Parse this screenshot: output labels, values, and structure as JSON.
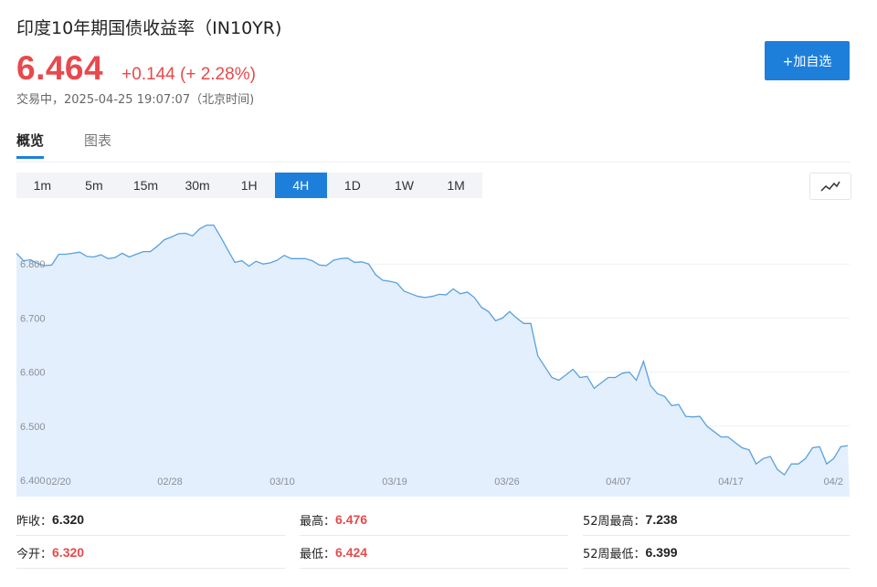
{
  "header": {
    "title": "印度10年期国债收益率（IN10YR)",
    "price": "6.464",
    "change": "+0.144 (+ 2.28%)",
    "status": "交易中，",
    "timestamp": "2025-04-25 19:07:07（北京时间)",
    "add_button": "+加自选"
  },
  "tabs": [
    {
      "label": "概览",
      "active": true
    },
    {
      "label": "图表",
      "active": false
    }
  ],
  "intervals": [
    {
      "label": "1m"
    },
    {
      "label": "5m"
    },
    {
      "label": "15m"
    },
    {
      "label": "30m"
    },
    {
      "label": "1H"
    },
    {
      "label": "4H",
      "active": true
    },
    {
      "label": "1D"
    },
    {
      "label": "1W"
    },
    {
      "label": "1M"
    }
  ],
  "chart_type_icon": "line-chart-icon",
  "colors": {
    "accent": "#1e7fdb",
    "up": "#e8494c",
    "line": "#5aa0e0",
    "area": "#e3effc"
  },
  "chart_data": {
    "type": "area",
    "ylim": [
      6.4,
      6.9
    ],
    "y_ticks": [
      "6.400",
      "6.500",
      "6.600",
      "6.700",
      "6.800"
    ],
    "x_tick_labels": [
      "02/20",
      "02/28",
      "03/10",
      "03/19",
      "03/26",
      "04/07",
      "04/17",
      "04/2"
    ],
    "grid": true,
    "values": [
      6.82,
      6.806,
      6.808,
      6.801,
      6.797,
      6.798,
      6.818,
      6.818,
      6.82,
      6.822,
      6.814,
      6.813,
      6.817,
      6.81,
      6.812,
      6.82,
      6.813,
      6.818,
      6.823,
      6.823,
      6.833,
      6.845,
      6.85,
      6.856,
      6.857,
      6.852,
      6.865,
      6.872,
      6.872,
      6.85,
      6.826,
      6.803,
      6.806,
      6.796,
      6.805,
      6.8,
      6.802,
      6.807,
      6.816,
      6.81,
      6.81,
      6.81,
      6.806,
      6.798,
      6.797,
      6.807,
      6.81,
      6.811,
      6.803,
      6.804,
      6.8,
      6.78,
      6.77,
      6.768,
      6.765,
      6.75,
      6.745,
      6.74,
      6.738,
      6.74,
      6.744,
      6.743,
      6.754,
      6.745,
      6.748,
      6.738,
      6.72,
      6.712,
      6.695,
      6.7,
      6.712,
      6.7,
      6.69,
      6.69,
      6.63,
      6.61,
      6.59,
      6.585,
      6.595,
      6.605,
      6.59,
      6.592,
      6.57,
      6.58,
      6.59,
      6.59,
      6.598,
      6.6,
      6.585,
      6.62,
      6.575,
      6.56,
      6.555,
      6.538,
      6.54,
      6.518,
      6.517,
      6.518,
      6.5,
      6.49,
      6.48,
      6.48,
      6.47,
      6.46,
      6.456,
      6.43,
      6.44,
      6.444,
      6.42,
      6.41,
      6.43,
      6.43,
      6.44,
      6.46,
      6.462,
      6.43,
      6.44,
      6.462,
      6.464
    ]
  },
  "stats": [
    {
      "label": "昨收：",
      "value": "6.320",
      "red": false
    },
    {
      "label": "最高：",
      "value": "6.476",
      "red": true
    },
    {
      "label": "52周最高：",
      "value": "7.238",
      "red": false
    },
    {
      "label": "今开：",
      "value": "6.320",
      "red": true
    },
    {
      "label": "最低：",
      "value": "6.424",
      "red": true
    },
    {
      "label": "52周最低：",
      "value": "6.399",
      "red": false
    }
  ]
}
